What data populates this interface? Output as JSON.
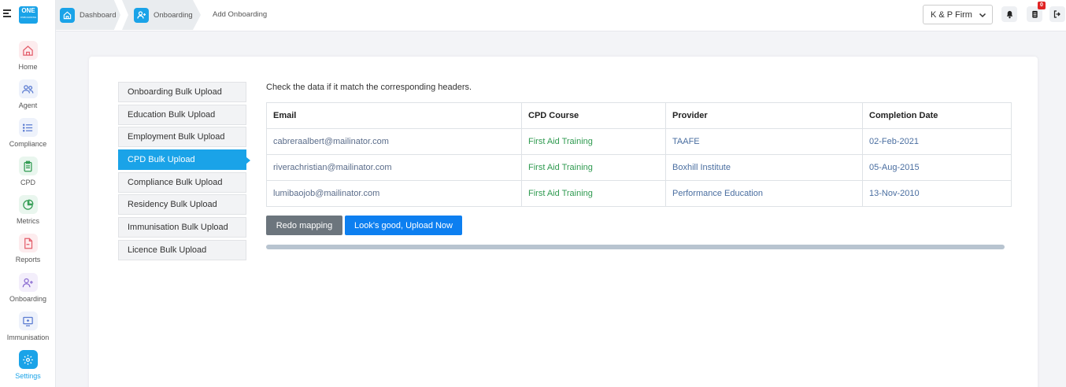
{
  "sidebar": {
    "logo": {
      "top": "ONE",
      "sub": "ONBOARDING"
    },
    "items": [
      {
        "label": "Home",
        "icon": "home-icon",
        "color": "#e35d6a",
        "bg": "#fdecee"
      },
      {
        "label": "Agent",
        "icon": "users-icon",
        "color": "#5a7bd1",
        "bg": "#eef2fb"
      },
      {
        "label": "Compliance",
        "icon": "list-icon",
        "color": "#5a7bd1",
        "bg": "#eef2fb"
      },
      {
        "label": "CPD",
        "icon": "clipboard-icon",
        "color": "#2f9a50",
        "bg": "#e9f6ee"
      },
      {
        "label": "Metrics",
        "icon": "pie-chart-icon",
        "color": "#2f9a50",
        "bg": "#e9f6ee"
      },
      {
        "label": "Reports",
        "icon": "file-icon",
        "color": "#e35d6a",
        "bg": "#fdecee"
      },
      {
        "label": "Onboarding",
        "icon": "user-plus-icon",
        "color": "#8a6bd1",
        "bg": "#f3eefb"
      },
      {
        "label": "Immunisation",
        "icon": "monitor-plus-icon",
        "color": "#5a7bd1",
        "bg": "#eef2fb"
      },
      {
        "label": "Settings",
        "icon": "gear-icon",
        "color": "#ffffff",
        "bg": "#1aa3e8"
      }
    ]
  },
  "breadcrumb": {
    "dashboard": "Dashboard",
    "onboarding": "Onboarding",
    "current": "Add Onboarding"
  },
  "header": {
    "firm": "K & P Firm",
    "notification_badge": "0"
  },
  "tabs": [
    "Onboarding Bulk Upload",
    "Education Bulk Upload",
    "Employment Bulk Upload",
    "CPD Bulk Upload",
    "Compliance Bulk Upload",
    "Residency Bulk Upload",
    "Immunisation Bulk Upload",
    "Licence Bulk Upload"
  ],
  "active_tab": "CPD Bulk Upload",
  "main": {
    "instruction": "Check the data if it match the corresponding headers.",
    "columns": [
      "Email",
      "CPD Course",
      "Provider",
      "Completion Date"
    ],
    "rows": [
      [
        "cabreraalbert@mailinator.com",
        "First Aid Training",
        "TAAFE",
        "02-Feb-2021"
      ],
      [
        "riverachristian@mailinator.com",
        "First Aid Training",
        "Boxhill Institute",
        "05-Aug-2015"
      ],
      [
        "lumibaojob@mailinator.com",
        "First Aid Training",
        "Performance Education",
        "13-Nov-2010"
      ]
    ],
    "redo_label": "Redo mapping",
    "upload_label": "Look's good, Upload Now"
  },
  "colors": {
    "accent": "#1aa3e8",
    "primary_button": "#0d7ff0",
    "secondary_button": "#6c757d"
  }
}
